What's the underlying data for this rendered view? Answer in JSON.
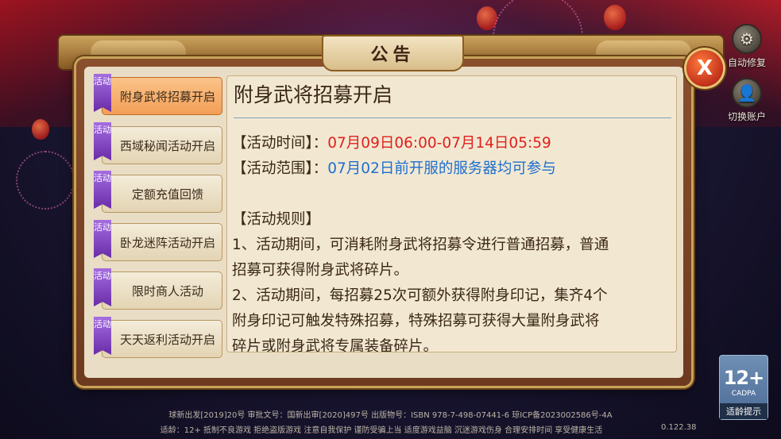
{
  "side": {
    "repair_label": "自动修复",
    "switch_label": "切换账户"
  },
  "dialog": {
    "title": "公告",
    "close_label": "X"
  },
  "tabs": [
    {
      "badge": "活动",
      "label": "附身武将招募开启",
      "active": true
    },
    {
      "badge": "活动",
      "label": "西域秘闻活动开启",
      "active": false
    },
    {
      "badge": "活动",
      "label": "定额充值回馈",
      "active": false
    },
    {
      "badge": "活动",
      "label": "卧龙迷阵活动开启",
      "active": false
    },
    {
      "badge": "活动",
      "label": "限时商人活动",
      "active": false
    },
    {
      "badge": "活动",
      "label": "天天返利活动开启",
      "active": false
    }
  ],
  "content": {
    "title": "附身武将招募开启",
    "time_label": "【活动时间】：",
    "time_value": "07月09日06:00-07月14日05:59",
    "range_label": "【活动范围】：",
    "range_value": "07月02日前开服的服务器均可参与",
    "rules_label": "【活动规则】",
    "rule1_a": "1、活动期间，可消耗附身武将招募令进行普通招募，普通",
    "rule1_b": "招募可获得附身武将碎片。",
    "rule2_a": "2、活动期间，每招募25次可额外获得附身印记，集齐4个",
    "rule2_b": "附身印记可触发特殊招募，特殊招募可获得大量附身武将",
    "rule2_c": "碎片或附身武将专属装备碎片。"
  },
  "age_badge": {
    "number": "12+",
    "org": "CADPA",
    "hint": "适龄提示"
  },
  "footer": {
    "line1": "球新出发[2019]20号 审批文号：国新出审[2020]497号 出版物号：ISBN 978-7-498-07441-6 琼ICP备2023002586号-4A",
    "line2": "适龄：12+   抵制不良游戏 拒绝盗版游戏 注意自我保护 谨防受骗上当 适度游戏益脑 沉迷游戏伤身 合理安排时间 享受健康生活",
    "version": "0.122.38"
  }
}
